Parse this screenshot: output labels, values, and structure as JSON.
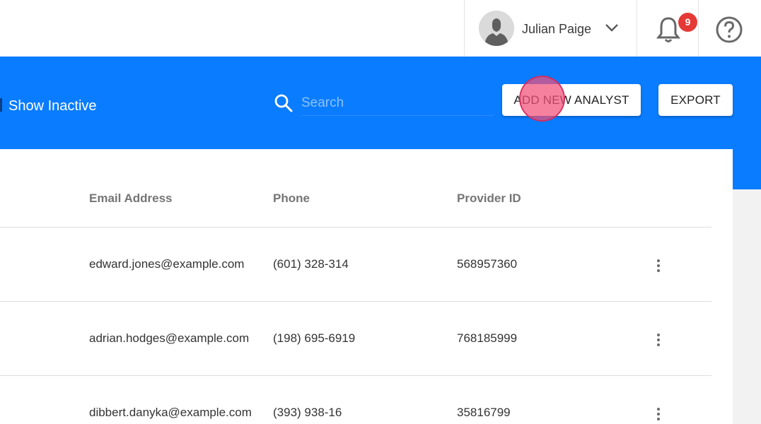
{
  "header": {
    "user": {
      "name": "Julian Paige"
    },
    "notifications": {
      "count": "9"
    }
  },
  "toolbar": {
    "show_inactive_label": "Show Inactive",
    "search": {
      "placeholder": "Search",
      "value": ""
    },
    "add_button_label": "ADD NEW ANALYST",
    "export_button_label": "EXPORT"
  },
  "table": {
    "columns": [
      "Email Address",
      "Phone",
      "Provider ID"
    ],
    "rows": [
      {
        "email": "edward.jones@example.com",
        "phone": "(601) 328-314",
        "provider_id": "568957360"
      },
      {
        "email": "adrian.hodges@example.com",
        "phone": "(198) 695-6919",
        "provider_id": "768185999"
      },
      {
        "email": "dibbert.danyka@example.com",
        "phone": "(393) 938-16",
        "provider_id": "35816799"
      }
    ]
  },
  "colors": {
    "accent_blue": "#0a7cff",
    "badge_red": "#e53935",
    "header_text_gray": "#757575",
    "click_indicator": "#f25078"
  },
  "icons": [
    "avatar-icon",
    "chevron-down-icon",
    "bell-icon",
    "help-icon",
    "search-icon",
    "more-vert-icon"
  ]
}
